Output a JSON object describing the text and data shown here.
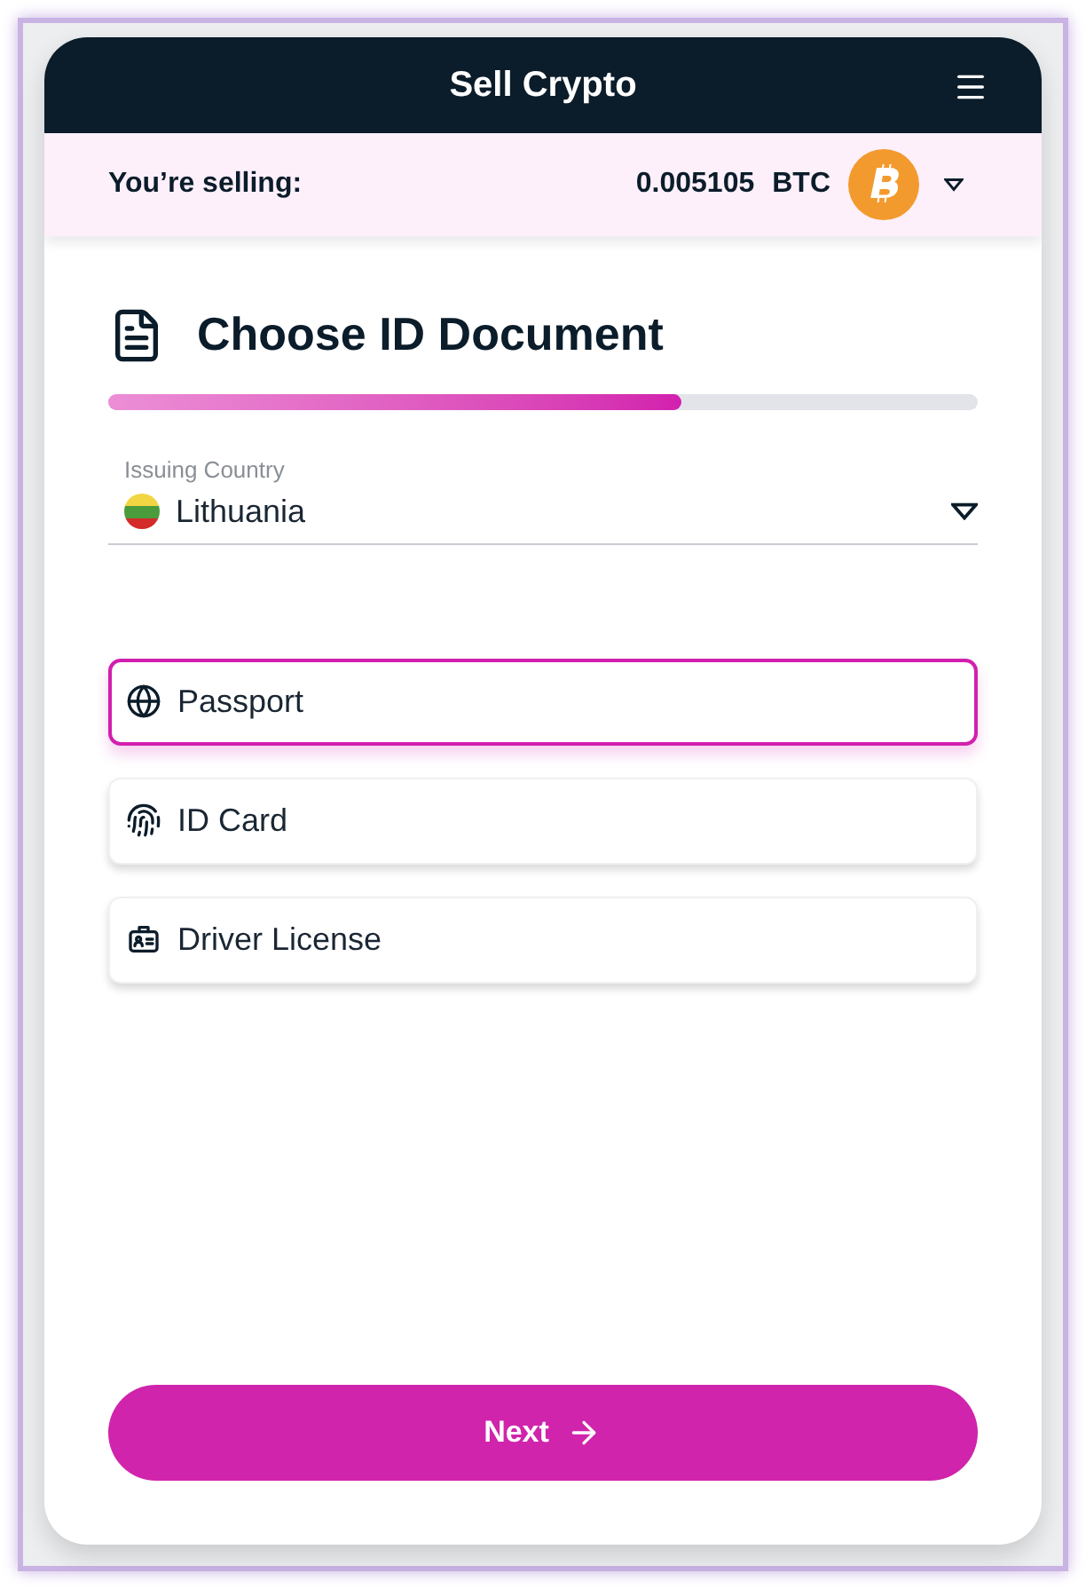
{
  "header": {
    "title": "Sell Crypto"
  },
  "selling": {
    "label": "You’re selling:",
    "amount": "0.005105",
    "currency": "BTC"
  },
  "step": {
    "title": "Choose ID Document",
    "level": 0.66
  },
  "country": {
    "label": "Issuing Country",
    "value": "Lithuania"
  },
  "documents": [
    {
      "label": "Passport",
      "kind": "globe",
      "selected": true
    },
    {
      "label": "ID Card",
      "kind": "fingerprint",
      "selected": false
    },
    {
      "label": "Driver License",
      "kind": "badge",
      "selected": false
    }
  ],
  "next_button": {
    "label": "Next"
  }
}
